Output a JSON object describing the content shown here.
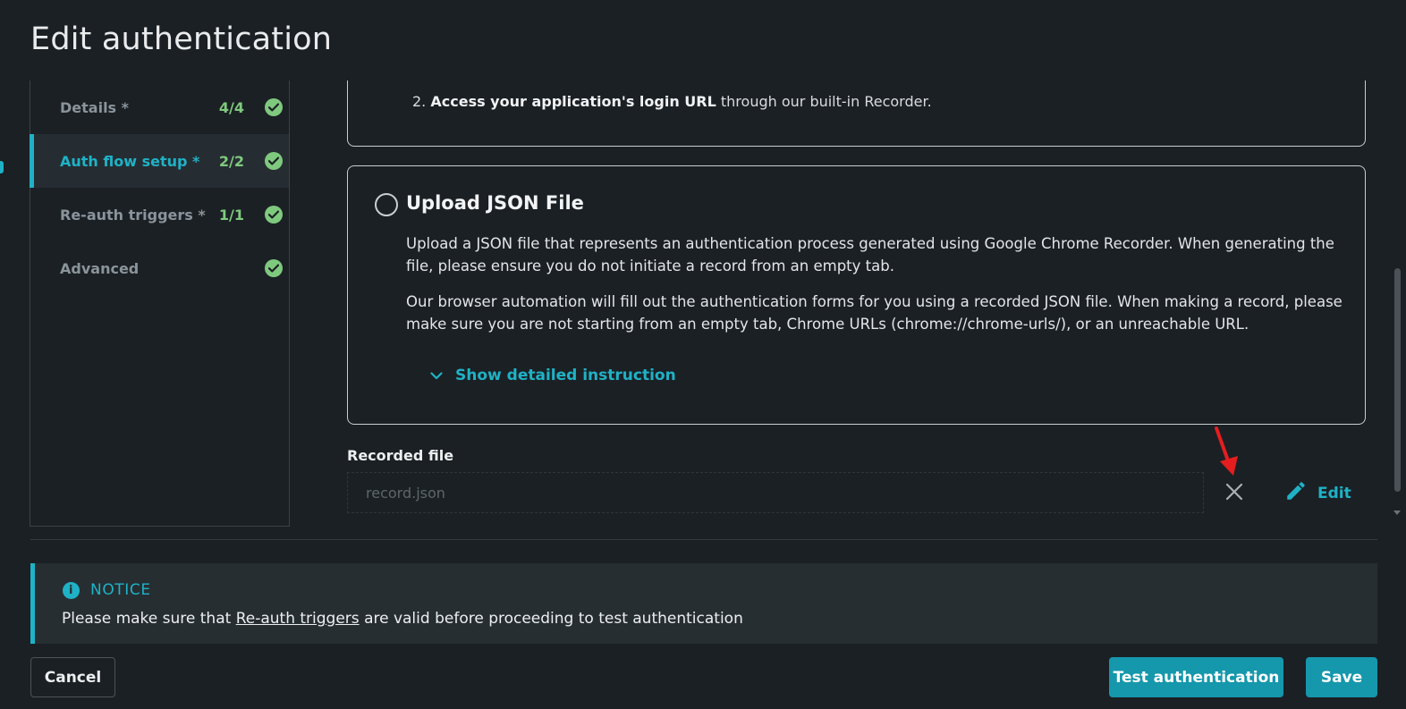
{
  "modal": {
    "title": "Edit authentication"
  },
  "sidebar": {
    "steps": [
      {
        "label": "Details *",
        "count": "4/4",
        "status": "complete",
        "active": false
      },
      {
        "label": "Auth flow setup *",
        "count": "2/2",
        "status": "complete",
        "active": true
      },
      {
        "label": "Re-auth triggers *",
        "count": "1/1",
        "status": "complete",
        "active": false
      },
      {
        "label": "Advanced",
        "count": "",
        "status": "complete",
        "active": false
      }
    ]
  },
  "main": {
    "prev_card": {
      "step_number": "2.",
      "bold_text": "Access your application's login URL",
      "rest_text": "through our built-in Recorder."
    },
    "json_option": {
      "title": "Upload JSON File",
      "selected": false,
      "paragraph1": "Upload a JSON file that represents an authentication process generated using Google Chrome Recorder. When generating the file, please ensure you do not initiate a record from an empty tab.",
      "paragraph2": "Our browser automation will fill out the authentication forms for you using a recorded JSON file. When making a record, please make sure you are not starting from an empty tab, Chrome URLs (chrome://chrome-urls/), or an unreachable URL.",
      "details_link": "Show detailed instruction"
    },
    "recorded_file": {
      "label": "Recorded file",
      "value": "",
      "placeholder": "record.json",
      "edit_label": "Edit"
    }
  },
  "notice": {
    "heading": "NOTICE",
    "text_before": "Please make sure that",
    "link_text": "Re-auth triggers",
    "text_after": "are valid before proceeding to test authentication"
  },
  "footer": {
    "cancel_label": "Cancel",
    "test_label": "Test authentication",
    "save_label": "Save"
  },
  "colors": {
    "background": "#1b2024",
    "accent": "#1fb2c6",
    "primary_button": "#1597ac",
    "success": "#7fc97e",
    "annotation_arrow": "#e41e1e"
  }
}
